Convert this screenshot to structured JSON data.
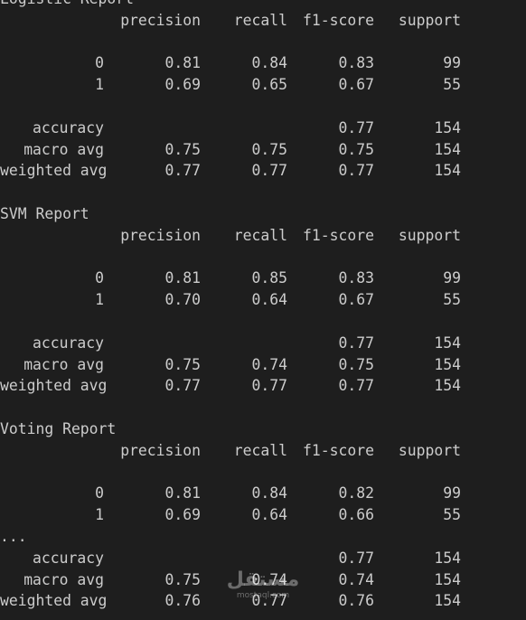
{
  "headers": [
    "precision",
    "recall",
    "f1-score",
    "support"
  ],
  "reports": [
    {
      "title": "Logistic Report",
      "class_rows": [
        {
          "label": "0",
          "precision": "0.81",
          "recall": "0.84",
          "f1": "0.83",
          "support": "99"
        },
        {
          "label": "1",
          "precision": "0.69",
          "recall": "0.65",
          "f1": "0.67",
          "support": "55"
        }
      ],
      "between": "",
      "accuracy": {
        "label": "accuracy",
        "f1": "0.77",
        "support": "154"
      },
      "avg_rows": [
        {
          "label": "macro avg",
          "precision": "0.75",
          "recall": "0.75",
          "f1": "0.75",
          "support": "154"
        },
        {
          "label": "weighted avg",
          "precision": "0.77",
          "recall": "0.77",
          "f1": "0.77",
          "support": "154"
        }
      ]
    },
    {
      "title": "SVM Report",
      "class_rows": [
        {
          "label": "0",
          "precision": "0.81",
          "recall": "0.85",
          "f1": "0.83",
          "support": "99"
        },
        {
          "label": "1",
          "precision": "0.70",
          "recall": "0.64",
          "f1": "0.67",
          "support": "55"
        }
      ],
      "between": "",
      "accuracy": {
        "label": "accuracy",
        "f1": "0.77",
        "support": "154"
      },
      "avg_rows": [
        {
          "label": "macro avg",
          "precision": "0.75",
          "recall": "0.74",
          "f1": "0.75",
          "support": "154"
        },
        {
          "label": "weighted avg",
          "precision": "0.77",
          "recall": "0.77",
          "f1": "0.77",
          "support": "154"
        }
      ]
    },
    {
      "title": "Voting Report",
      "class_rows": [
        {
          "label": "0",
          "precision": "0.81",
          "recall": "0.84",
          "f1": "0.82",
          "support": "99"
        },
        {
          "label": "1",
          "precision": "0.69",
          "recall": "0.64",
          "f1": "0.66",
          "support": "55"
        }
      ],
      "between": "...",
      "accuracy": {
        "label": "accuracy",
        "f1": "0.77",
        "support": "154"
      },
      "avg_rows": [
        {
          "label": "macro avg",
          "precision": "0.75",
          "recall": "0.74",
          "f1": "0.74",
          "support": "154"
        },
        {
          "label": "weighted avg",
          "precision": "0.76",
          "recall": "0.77",
          "f1": "0.76",
          "support": "154"
        }
      ]
    }
  ],
  "watermark": {
    "main": "مستقل",
    "sub": "mostaql.com"
  }
}
